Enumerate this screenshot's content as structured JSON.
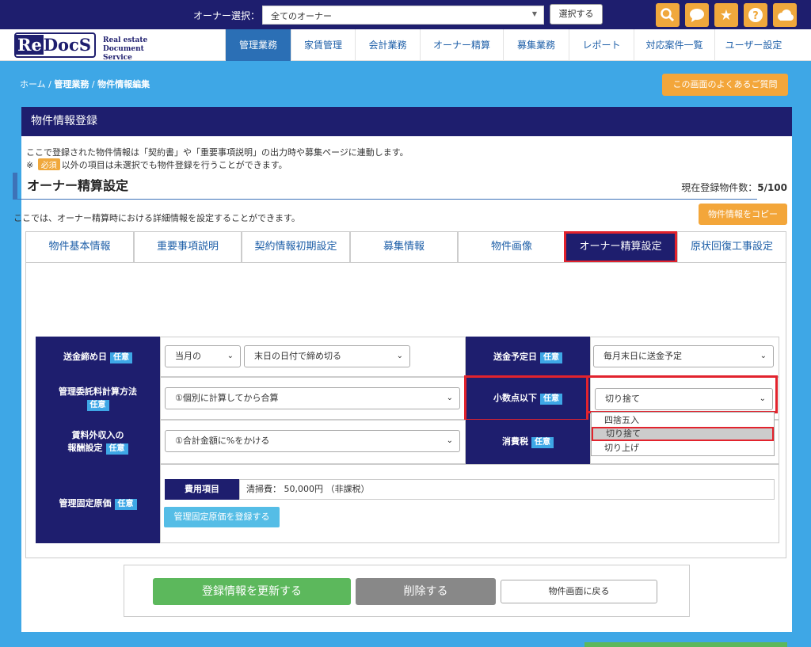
{
  "topbar": {
    "owner_label": "オーナー選択：",
    "owner_value": "全てのオーナー",
    "select_button": "選択する",
    "icons": [
      "search-icon",
      "chat-icon",
      "star-icon",
      "help-icon",
      "cloud-icon"
    ]
  },
  "logo": {
    "re": "Re",
    "docs": "DocS",
    "sub1": "Real estate",
    "sub2": "Document Service"
  },
  "nav": [
    "管理業務",
    "家賃管理",
    "会計業務",
    "オーナー精算",
    "募集業務",
    "レポート",
    "対応案件一覧",
    "ユーザー設定"
  ],
  "breadcrumb": {
    "home": "ホーム",
    "sep": "/",
    "level1": "管理業務",
    "current": "物件情報編集"
  },
  "faq_button": "この画面のよくあるご質問",
  "panel": {
    "title": "物件情報登録",
    "intro1": "ここで登録された物件情報は「契約書」や「重要事項説明」の出力時や募集ページに連動します。",
    "intro2_prefix": "※",
    "required_badge": "必須",
    "intro2_suffix": "以外の項目は未選択でも物件登録を行うことができます。",
    "count_label": "現在登録物件数：",
    "count_value": "5/100",
    "copy_button": "物件情報をコピー"
  },
  "tabs": [
    "物件基本情報",
    "重要事項説明",
    "契約情報初期設定",
    "募集情報",
    "物件画像",
    "オーナー精算設定",
    "原状回復工事設定"
  ],
  "section": {
    "title": "オーナー精算設定",
    "desc": "ここでは、オーナー精算時における詳細情報を設定することができます。"
  },
  "optional_tag": "任意",
  "form": {
    "closing_day": {
      "label": "送金締め日",
      "month": "当月の",
      "rule": "末日の日付で締め切る"
    },
    "remit_date": {
      "label": "送金予定日",
      "value": "毎月末日に送金予定"
    },
    "commission": {
      "label1": "管理委託料計算方法",
      "value": "①個別に計算してから合算"
    },
    "decimal": {
      "label": "小数点以下",
      "value": "切り捨て",
      "options": [
        "四捨五入",
        "切り捨て",
        "切り上げ"
      ]
    },
    "non_rent": {
      "label1": "賃料外収入の",
      "label2": "報酬設定",
      "value": "①合計金額に%をかける"
    },
    "tax": {
      "label": "消費税"
    },
    "fixed_cost": {
      "label": "管理固定原価",
      "fee_head": "費用項目",
      "fee_value": "清掃費： 50,000円 （非課税）",
      "register_button": "管理固定原価を登録する"
    }
  },
  "footer": {
    "update": "登録情報を更新する",
    "delete": "削除する",
    "back": "物件画面に戻る"
  },
  "colors": {
    "navy": "#1e1e6e",
    "accent_orange": "#f3a63a",
    "tag_blue": "#3ea7e6",
    "highlight_red": "#e2232d",
    "green": "#5cb85c"
  }
}
